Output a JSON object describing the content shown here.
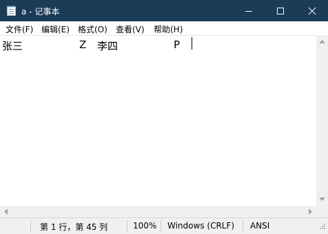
{
  "window": {
    "title": "a - 记事本",
    "titlebar_color": "#1b3b57"
  },
  "menu": {
    "items": [
      {
        "label": "文件(F)"
      },
      {
        "label": "编辑(E)"
      },
      {
        "label": "格式(O)"
      },
      {
        "label": "查看(V)"
      },
      {
        "label": "帮助(H)"
      }
    ]
  },
  "editor": {
    "text_segments": [
      "张三",
      "Z",
      "李四",
      "P"
    ]
  },
  "status": {
    "position": "第 1 行，第 45 列",
    "zoom": "100%",
    "line_ending": "Windows (CRLF)",
    "encoding": "ANSI"
  },
  "icons": {
    "app": "notepad-icon",
    "minimize": "minimize-icon",
    "maximize": "maximize-icon",
    "close": "close-icon"
  }
}
